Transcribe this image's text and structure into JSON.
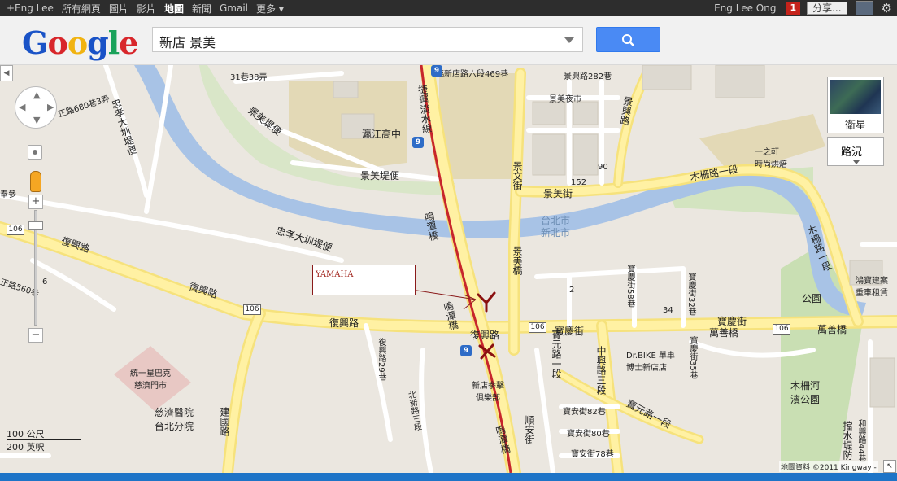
{
  "topbar": {
    "nav_items": [
      "+Eng Lee",
      "所有網頁",
      "圖片",
      "影片",
      "地圖",
      "新聞",
      "Gmail",
      "更多 ▾"
    ],
    "active_item": "地圖",
    "user_name": "Eng Lee Ong",
    "notification_count": "1",
    "share_label": "分享..."
  },
  "search": {
    "logo_text": "Google",
    "query": "新店 景美",
    "button_icon": "search-icon"
  },
  "map_controls": {
    "satellite_label": "衛星",
    "traffic_label": "路況",
    "zoom_in": "+",
    "zoom_out": "−"
  },
  "map_labels": {
    "roads": {
      "fuxing_w": "復興路",
      "fuxing_c": "復興路",
      "fuxing_e": "復興路",
      "fuxing_mid": "復興路",
      "zhengxiao": "忠孝大圳堤便",
      "zhengxiao_v": "忠孝大圳堤便",
      "jingmei_dike_1": "景美堤便",
      "jingmei_dike_2": "景美堤便",
      "jingmei_st": "景美街",
      "jingwen": "景文街",
      "jingmei_bridge": "景美橋",
      "mingtan_n": "嗚潭橋",
      "mingtan_s": "嗚潭橋",
      "mingtan_c": "嗚潭橋",
      "mucha": "木柵路一段",
      "mucha_v": "木柵路一段",
      "baoqing_w": "寶慶街",
      "baoqing_e": "寶慶街",
      "wanshan_1": "萬善橋",
      "wanshan_2": "萬善橋",
      "baoyuan_1": "寶元路一段",
      "baoyuan_2": "寶元路一段",
      "zhongxing": "中興路三段",
      "shunan": "順安街",
      "baoan_82": "寶安街82巷",
      "baoan_80": "寶安街80巷",
      "baoan_78": "寶安街78巷",
      "jianguo": "建國路",
      "beixin": "北新路三段",
      "alley_31": "31巷38弄",
      "alley_680": "正路680巷3弄",
      "alley_560": "正路560巷",
      "fuxing_29": "復興路29巷",
      "baoqing_58": "寶慶街58巷",
      "baoqing_32": "寶慶街32巷",
      "baoqing_35": "寶慶街35巷",
      "jingxing_282": "景興路282巷",
      "dashui": "擋水堤防",
      "hexing": "和興路44巷",
      "jingxing_top": "景興路",
      "dianzheng": "臨新店路六段469巷",
      "yuanshan": "捷運淡水線"
    },
    "places": {
      "jingmei_night": "景美夜市",
      "jinggang": "瀛江高中",
      "hospital": "慈濟醫院\n台北分院",
      "starbucks": "統一星巴克\n慈濟門市",
      "club": "新店拳擊\n俱樂部",
      "drbike": "Dr.BIKE 單車\n博士新店店",
      "park": "公園",
      "muzha_park": "木柵河\n濱公園",
      "taipei": "台北市",
      "newtaipei": "新北市",
      "cafe": "一之軒\n時尚烘焙",
      "jingmei_dian": "鴻寶建案\n重車租賃",
      "num_2": "2",
      "num_34": "34",
      "num_152": "152",
      "num_90": "90",
      "num_6": "6",
      "num_m": "奉參"
    },
    "routes": {
      "r106_1": "106",
      "r106_2": "106",
      "r106_3": "106",
      "r106_4": "106",
      "r9_1": "9",
      "r9_2": "9",
      "r9_3": "9"
    }
  },
  "annotation": {
    "box_text": "YAMAHA"
  },
  "scale": {
    "metric": "100 公尺",
    "imperial": "200 英呎"
  },
  "copyright": "地圖資料 ©2011 Kingway -"
}
